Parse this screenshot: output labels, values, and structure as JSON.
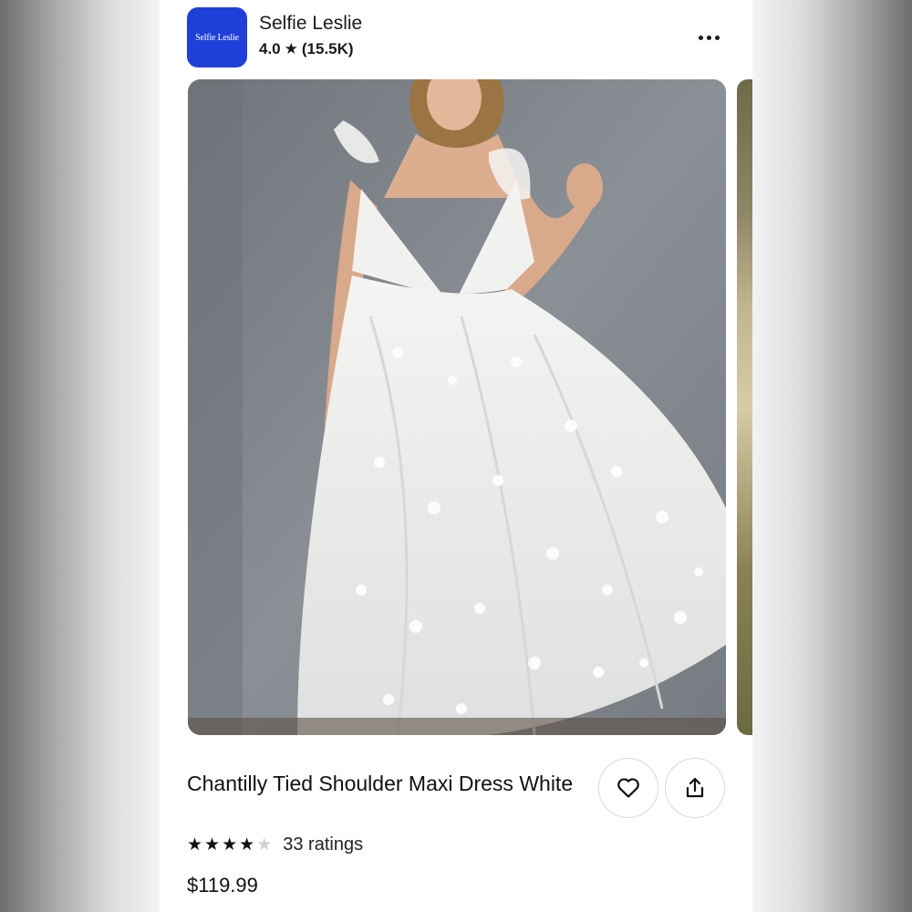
{
  "store": {
    "logo_text": "Selfie Leslie",
    "name": "Selfie Leslie",
    "rating": "4.0",
    "rating_count": "(15.5K)",
    "brand_color": "#1f3fd9"
  },
  "product": {
    "image_icon": "photo",
    "title": "Chantilly Tied Shoulder Maxi Dress White",
    "stars": 3.5,
    "ratings_label": "33 ratings",
    "price": "$119.99"
  },
  "icons": {
    "more": "more-horizontal-icon",
    "favorite": "heart-icon",
    "share": "share-icon",
    "star": "star-icon"
  }
}
